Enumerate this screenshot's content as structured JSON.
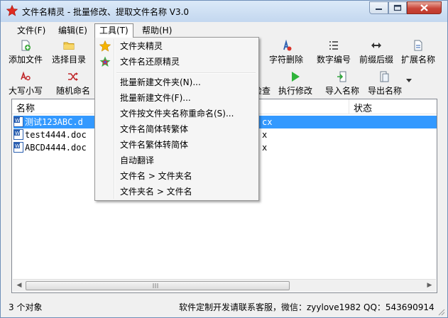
{
  "window": {
    "title": "文件名精灵 - 批量修改、提取文件名称  V3.0"
  },
  "menubar": [
    {
      "label": "文件(F)"
    },
    {
      "label": "编辑(E)"
    },
    {
      "label": "工具(T)"
    },
    {
      "label": "帮助(H)"
    }
  ],
  "toolbar1": [
    {
      "label": "添加文件",
      "icon": "add-file-icon"
    },
    {
      "label": "选择目录",
      "icon": "folder-icon"
    },
    {
      "label": "字符删除",
      "icon": "char-delete-icon"
    },
    {
      "label": "数字编号",
      "icon": "numbering-icon"
    },
    {
      "label": "前缀后缀",
      "icon": "prefix-suffix-icon"
    },
    {
      "label": "扩展名称",
      "icon": "extension-icon"
    }
  ],
  "toolbar2": [
    {
      "label": "大写小写",
      "icon": "case-icon"
    },
    {
      "label": "随机命名",
      "icon": "shuffle-icon"
    },
    {
      "label": "检查",
      "icon": "check-icon"
    },
    {
      "label": "执行修改",
      "icon": "play-icon"
    },
    {
      "label": "导入名称",
      "icon": "import-icon"
    },
    {
      "label": "导出名称",
      "icon": "export-icon"
    }
  ],
  "list": {
    "columns": [
      "名称",
      "状态"
    ],
    "rows": [
      {
        "name": "测试123ABC.d",
        "tail": "cx",
        "selected": true
      },
      {
        "name": "test4444.doc",
        "tail": "x",
        "selected": false
      },
      {
        "name": "ABCD4444.doc",
        "tail": "x",
        "selected": false
      }
    ]
  },
  "tools_menu": {
    "items": [
      {
        "label": "文件夹精灵",
        "icon": "star-icon"
      },
      {
        "label": "文件名还原精灵",
        "icon": "colorful-star-icon"
      },
      {
        "label": "批量新建文件夹(N)..."
      },
      {
        "label": "批量新建文件(F)..."
      },
      {
        "label": "文件按文件夹名称重命名(S)..."
      },
      {
        "label": "文件名简体转繁体"
      },
      {
        "label": "文件名繁体转简体"
      },
      {
        "label": "自动翻译"
      },
      {
        "label": "文件名 > 文件夹名"
      },
      {
        "label": "文件夹名 > 文件名"
      }
    ]
  },
  "status": {
    "count": "3 个对象",
    "contact": "软件定制开发请联系客服，微信：zyylove1982  QQ：543690914"
  },
  "colors": {
    "selection": "#3399ff",
    "accent": "#0066cc"
  }
}
